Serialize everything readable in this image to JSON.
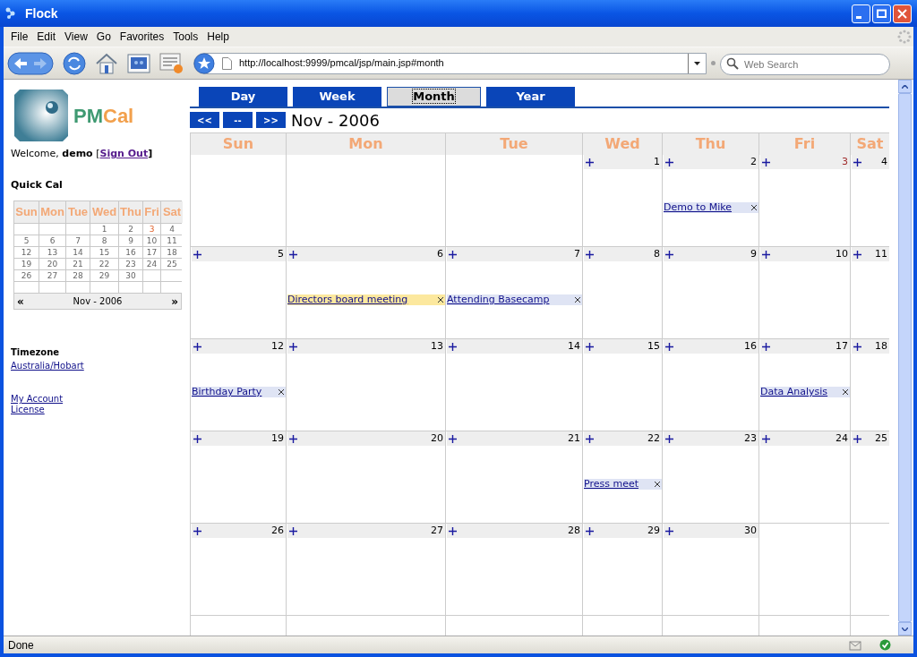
{
  "window": {
    "title": "Flock"
  },
  "menu": [
    "File",
    "Edit",
    "View",
    "Go",
    "Favorites",
    "Tools",
    "Help"
  ],
  "address_bar": {
    "value": "http://localhost:9999/pmcal/jsp/main.jsp#month"
  },
  "search": {
    "placeholder": "Web Search"
  },
  "sidebar": {
    "logo": [
      {
        "text": "PM",
        "color": "#3f9a72"
      },
      {
        "text": "Cal",
        "color": "#f2a04c"
      }
    ],
    "welcome": {
      "text": "Welcome, **demo** [",
      "link": "Sign Out",
      "end": "]"
    },
    "quick_cal": {
      "title": "Quick Cal",
      "weekdays": [
        "Sun",
        "Mon",
        "Tue",
        "Wed",
        "Thu",
        "Fri",
        "Sat"
      ],
      "weeks": [
        [
          {
            "kind": "blank"
          },
          {
            "kind": "blank"
          },
          {
            "kind": "blank"
          },
          {
            "kind": "day",
            "day": "1",
            "today": false
          },
          {
            "kind": "day",
            "day": "2",
            "today": false
          },
          {
            "kind": "day",
            "day": "3",
            "today": true
          },
          {
            "kind": "day",
            "day": "4",
            "today": false
          }
        ],
        [
          {
            "kind": "day",
            "day": "5",
            "today": false
          },
          {
            "kind": "day",
            "day": "6",
            "today": false
          },
          {
            "kind": "day",
            "day": "7",
            "today": false
          },
          {
            "kind": "day",
            "day": "8",
            "today": false
          },
          {
            "kind": "day",
            "day": "9",
            "today": false
          },
          {
            "kind": "day",
            "day": "10",
            "today": false
          },
          {
            "kind": "day",
            "day": "11",
            "today": false
          }
        ],
        [
          {
            "kind": "day",
            "day": "12",
            "today": false
          },
          {
            "kind": "day",
            "day": "13",
            "today": false
          },
          {
            "kind": "day",
            "day": "14",
            "today": false
          },
          {
            "kind": "day",
            "day": "15",
            "today": false
          },
          {
            "kind": "day",
            "day": "16",
            "today": false
          },
          {
            "kind": "day",
            "day": "17",
            "today": false
          },
          {
            "kind": "day",
            "day": "18",
            "today": false
          }
        ],
        [
          {
            "kind": "day",
            "day": "19",
            "today": false
          },
          {
            "kind": "day",
            "day": "20",
            "today": false
          },
          {
            "kind": "day",
            "day": "21",
            "today": false
          },
          {
            "kind": "day",
            "day": "22",
            "today": false
          },
          {
            "kind": "day",
            "day": "23",
            "today": false
          },
          {
            "kind": "day",
            "day": "24",
            "today": false
          },
          {
            "kind": "day",
            "day": "25",
            "today": false
          }
        ],
        [
          {
            "kind": "day",
            "day": "26",
            "today": false
          },
          {
            "kind": "day",
            "day": "27",
            "today": false
          },
          {
            "kind": "day",
            "day": "28",
            "today": false
          },
          {
            "kind": "day",
            "day": "29",
            "today": false
          },
          {
            "kind": "day",
            "day": "30",
            "today": false
          },
          {
            "kind": "blank"
          },
          {
            "kind": "blank"
          }
        ]
      ],
      "prev": "«",
      "month": "Nov - 2006",
      "next": "»"
    },
    "timezone": {
      "label": "Timezone",
      "value": "Australia/Hobart"
    },
    "links": [
      "My Account",
      "License"
    ]
  },
  "calendar": {
    "tabs": [
      {
        "label": "Day",
        "selected": false
      },
      {
        "label": "Week",
        "selected": false
      },
      {
        "label": "Month",
        "selected": true
      },
      {
        "label": "Year",
        "selected": false
      }
    ],
    "nav": [
      "<<",
      "--",
      ">>"
    ],
    "title": "Nov - 2006",
    "weekdays": [
      "Sun",
      "Mon",
      "Tue",
      "Wed",
      "Thu",
      "Fri",
      "Sat"
    ],
    "weeks": [
      [
        {
          "kind": "blank"
        },
        {
          "kind": "blank"
        },
        {
          "kind": "blank"
        },
        {
          "kind": "day",
          "day": "1",
          "today": false
        },
        {
          "kind": "day",
          "day": "2",
          "today": false,
          "events": [
            {
              "title": "Demo to Mike",
              "color": "#dfe4f4"
            }
          ]
        },
        {
          "kind": "day",
          "day": "3",
          "today": true
        },
        {
          "kind": "day",
          "day": "4",
          "today": false
        }
      ],
      [
        {
          "kind": "day",
          "day": "5",
          "today": false
        },
        {
          "kind": "day",
          "day": "6",
          "today": false,
          "events": [
            {
              "title": "Directors board meeting",
              "color": "#fce89e"
            }
          ]
        },
        {
          "kind": "day",
          "day": "7",
          "today": false,
          "events": [
            {
              "title": "Attending Basecamp",
              "color": "#dfe4f4"
            }
          ]
        },
        {
          "kind": "day",
          "day": "8",
          "today": false
        },
        {
          "kind": "day",
          "day": "9",
          "today": false
        },
        {
          "kind": "day",
          "day": "10",
          "today": false
        },
        {
          "kind": "day",
          "day": "11",
          "today": false
        }
      ],
      [
        {
          "kind": "day",
          "day": "12",
          "today": false,
          "events": [
            {
              "title": "Birthday Party",
              "color": "#dfe4f4"
            }
          ]
        },
        {
          "kind": "day",
          "day": "13",
          "today": false
        },
        {
          "kind": "day",
          "day": "14",
          "today": false
        },
        {
          "kind": "day",
          "day": "15",
          "today": false
        },
        {
          "kind": "day",
          "day": "16",
          "today": false
        },
        {
          "kind": "day",
          "day": "17",
          "today": false,
          "events": [
            {
              "title": "Data Analysis",
              "color": "#dfe4f4"
            }
          ]
        },
        {
          "kind": "day",
          "day": "18",
          "today": false
        }
      ],
      [
        {
          "kind": "day",
          "day": "19",
          "today": false
        },
        {
          "kind": "day",
          "day": "20",
          "today": false
        },
        {
          "kind": "day",
          "day": "21",
          "today": false
        },
        {
          "kind": "day",
          "day": "22",
          "today": false,
          "events": [
            {
              "title": "Press meet",
              "color": "#dfe4f4"
            }
          ]
        },
        {
          "kind": "day",
          "day": "23",
          "today": false
        },
        {
          "kind": "day",
          "day": "24",
          "today": false
        },
        {
          "kind": "day",
          "day": "25",
          "today": false
        }
      ],
      [
        {
          "kind": "day",
          "day": "26",
          "today": false
        },
        {
          "kind": "day",
          "day": "27",
          "today": false
        },
        {
          "kind": "day",
          "day": "28",
          "today": false
        },
        {
          "kind": "day",
          "day": "29",
          "today": false
        },
        {
          "kind": "day",
          "day": "30",
          "today": false
        },
        {
          "kind": "blank"
        },
        {
          "kind": "blank"
        }
      ]
    ]
  },
  "status_bar": {
    "text": "Done"
  }
}
